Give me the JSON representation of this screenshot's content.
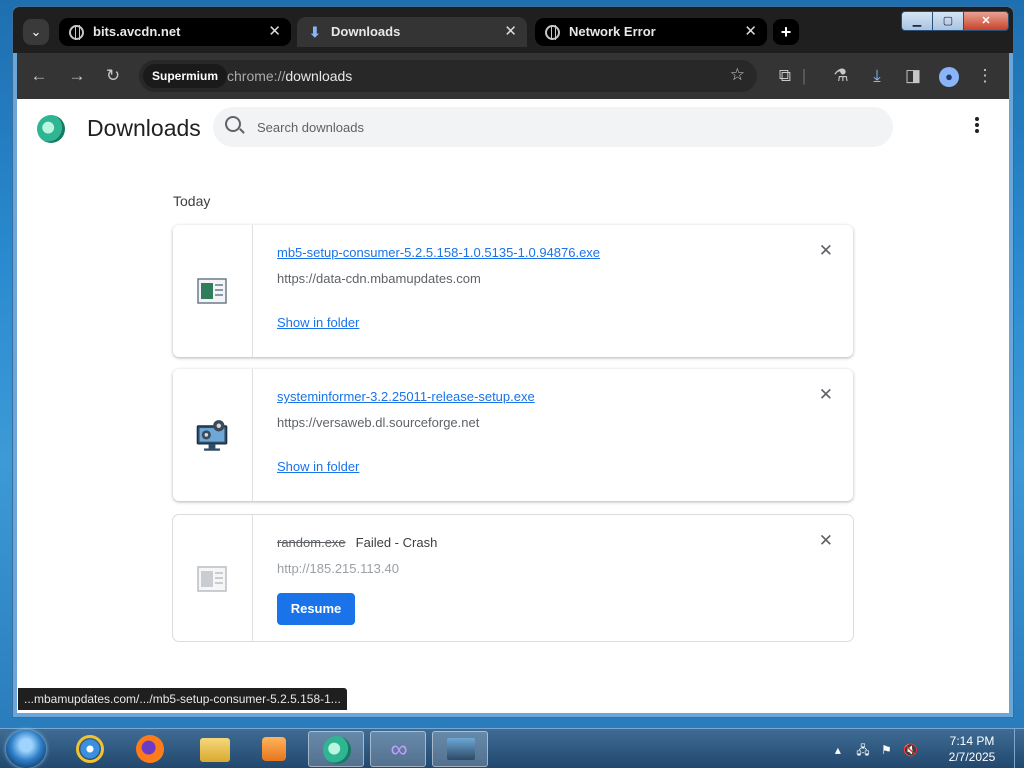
{
  "browser": {
    "tabs": [
      {
        "title": "bits.avcdn.net",
        "active": false
      },
      {
        "title": "Downloads",
        "active": true
      },
      {
        "title": "Network Error",
        "active": false
      }
    ],
    "new_tab_label": "+",
    "site_chip": "Supermium",
    "url_scheme": "chrome://",
    "url_path": "downloads"
  },
  "page": {
    "title": "Downloads",
    "search_placeholder": "Search downloads",
    "date_header": "Today",
    "downloads": [
      {
        "filename": "mb5-setup-consumer-5.2.5.158-1.0.5135-1.0.94876.exe",
        "source": "https://data-cdn.mbamupdates.com",
        "action": "Show in folder",
        "status": ""
      },
      {
        "filename": "systeminformer-3.2.25011-release-setup.exe",
        "source": "https://versaweb.dl.sourceforge.net",
        "action": "Show in folder",
        "status": ""
      },
      {
        "filename": "random.exe",
        "source": "http://185.215.113.40",
        "action": "Resume",
        "status": "Failed - Crash"
      }
    ]
  },
  "status_bar_url": "...mbamupdates.com/.../mb5-setup-consumer-5.2.5.158-1...",
  "taskbar": {
    "clock_time": "7:14 PM",
    "clock_date": "2/7/2025"
  },
  "colors": {
    "link": "#1a73e8",
    "titlebar": "#1f1f1f",
    "toolbar": "#343434"
  }
}
